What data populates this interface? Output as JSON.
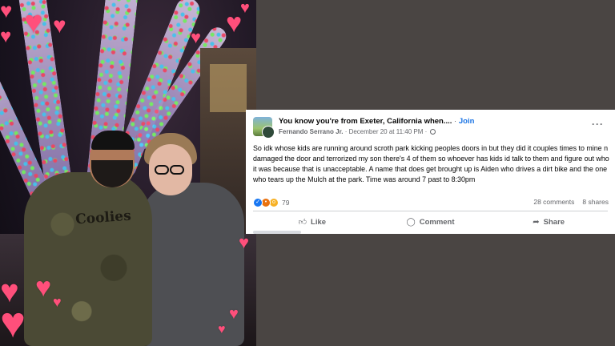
{
  "post": {
    "group_name": "You know you're from Exeter, California when....",
    "separator": " · ",
    "join_label": "Join",
    "author": "Fernando Serrano Jr.",
    "date": "December 20 at 11:40 PM",
    "body": "So idk whose kids are running around scroth park kicking peoples doors in but they did it couples times to mine n damaged the door and terrorized my son there's 4 of them so whoever has kids id talk to them and figure out who it was because that is unacceptable. A name that does get brought up is Aiden who drives a dirt bike and the one who tears up the Mulch at the park. Time was around 7 past to 8:30pm",
    "reaction_count": "79",
    "comments": "28 comments",
    "shares": "8 shares",
    "actions": {
      "like": "Like",
      "comment": "Comment",
      "share": "Share"
    }
  },
  "photo": {
    "shirt_text": "Coolies"
  },
  "icons": [
    "more-icon",
    "globe-icon",
    "like-reaction-icon",
    "angry-reaction-icon",
    "wow-reaction-icon",
    "like-icon",
    "comment-icon",
    "share-icon",
    "heart-icon"
  ],
  "colors": {
    "background": "#4a4543",
    "link": "#1b74e4",
    "heart": "#ff4f7b"
  }
}
